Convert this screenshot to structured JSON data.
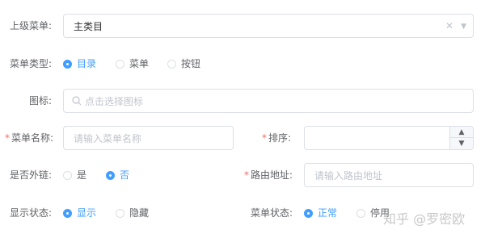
{
  "form": {
    "parent_menu": {
      "label": "上级菜单:",
      "value": "主类目"
    },
    "menu_type": {
      "label": "菜单类型:",
      "options": [
        {
          "label": "目录",
          "selected": true
        },
        {
          "label": "菜单",
          "selected": false
        },
        {
          "label": "按钮",
          "selected": false
        }
      ]
    },
    "icon": {
      "label": "图标:",
      "placeholder": "点击选择图标"
    },
    "menu_name": {
      "required_mark": "*",
      "label": "菜单名称:",
      "placeholder": "请输入菜单名称"
    },
    "sort": {
      "required_mark": "*",
      "label": "排序:",
      "value": ""
    },
    "external_link": {
      "label": "是否外链:",
      "options": [
        {
          "label": "是",
          "selected": false
        },
        {
          "label": "否",
          "selected": true
        }
      ]
    },
    "route_path": {
      "required_mark": "*",
      "label": "路由地址:",
      "placeholder": "请输入路由地址"
    },
    "display_status": {
      "label": "显示状态:",
      "options": [
        {
          "label": "显示",
          "selected": true
        },
        {
          "label": "隐藏",
          "selected": false
        }
      ]
    },
    "menu_status": {
      "label": "菜单状态:",
      "options": [
        {
          "label": "正常",
          "selected": true
        },
        {
          "label": "停用",
          "selected": false
        }
      ]
    }
  },
  "watermark": "知乎 @罗密欧",
  "colors": {
    "accent": "#409eff",
    "required": "#f56c6c",
    "border": "#dcdfe6",
    "placeholder": "#c0c4cc"
  }
}
